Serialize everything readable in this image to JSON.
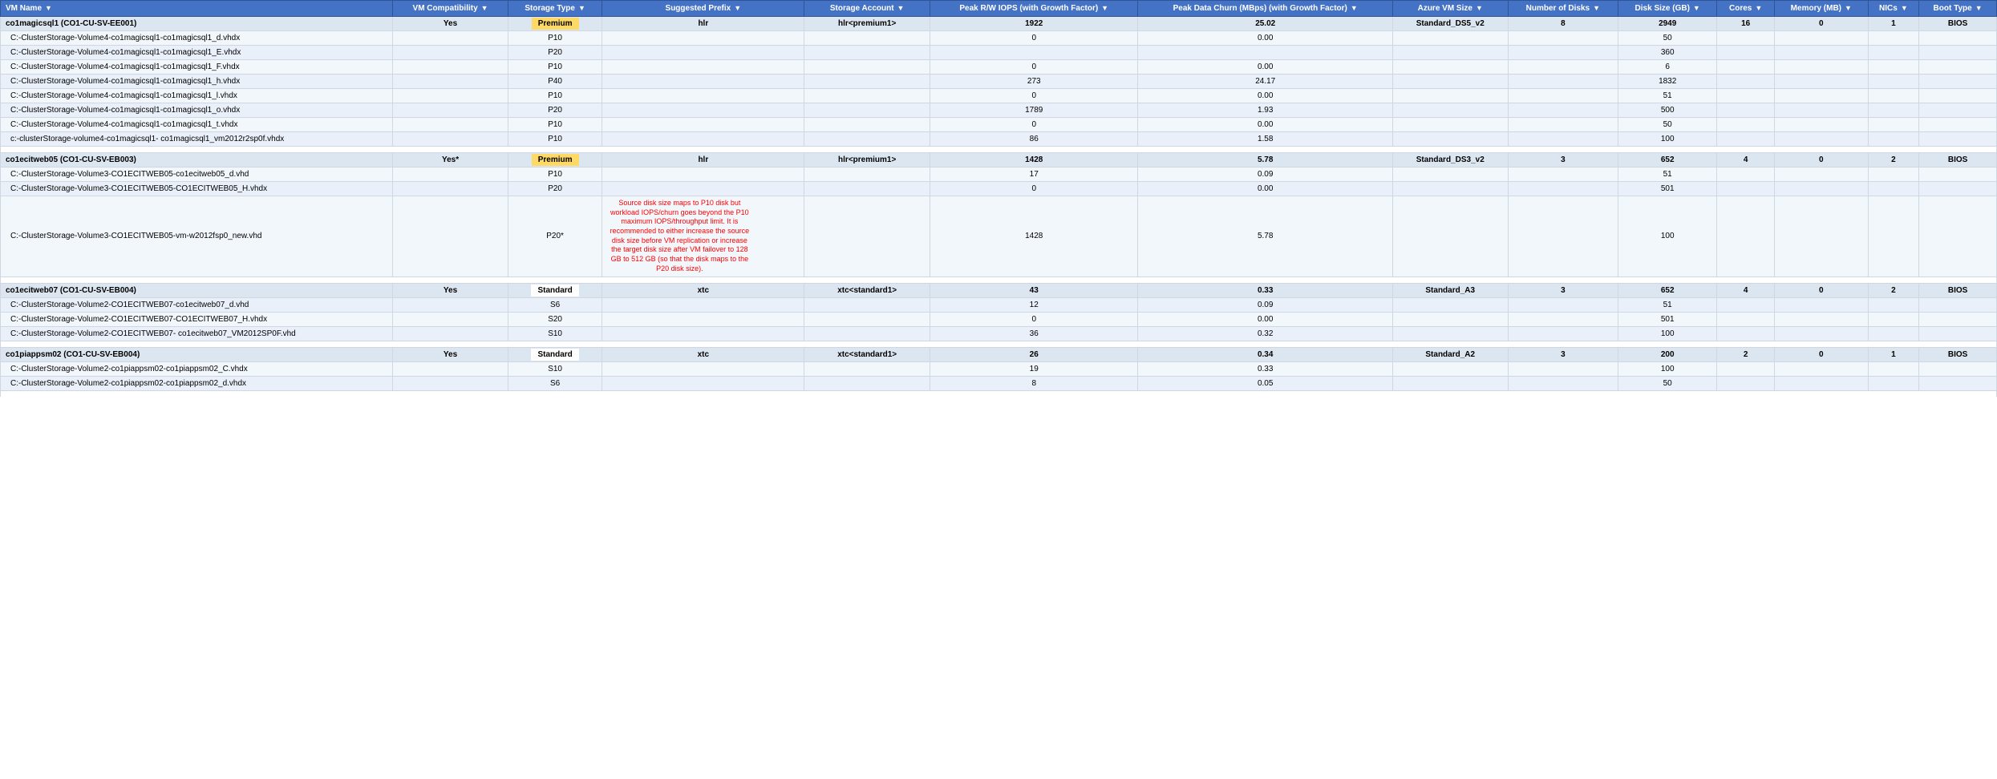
{
  "columns": [
    {
      "id": "vm-name",
      "label": "VM Name",
      "class": "col-vm-name"
    },
    {
      "id": "vm-compat",
      "label": "VM Compatibility",
      "class": "col-vm-compat"
    },
    {
      "id": "storage-type",
      "label": "Storage Type",
      "class": "col-storage-type"
    },
    {
      "id": "suggested-prefix",
      "label": "Suggested Prefix",
      "class": "col-suggested-prefix"
    },
    {
      "id": "storage-account",
      "label": "Storage Account",
      "class": "col-storage-account"
    },
    {
      "id": "peak-rw",
      "label": "Peak R/W IOPS (with Growth Factor)",
      "class": "col-peak-rw"
    },
    {
      "id": "peak-churn",
      "label": "Peak Data Churn (MBps) (with Growth Factor)",
      "class": "col-peak-churn"
    },
    {
      "id": "azure-vm",
      "label": "Azure VM Size",
      "class": "col-azure-vm"
    },
    {
      "id": "num-disks",
      "label": "Number of Disks",
      "class": "col-num-disks"
    },
    {
      "id": "disk-size",
      "label": "Disk Size (GB)",
      "class": "col-disk-size"
    },
    {
      "id": "cores",
      "label": "Cores",
      "class": "col-cores"
    },
    {
      "id": "memory",
      "label": "Memory (MB)",
      "class": "col-memory"
    },
    {
      "id": "nics",
      "label": "NICs",
      "class": "col-nics"
    },
    {
      "id": "boot-type",
      "label": "Boot Type",
      "class": "col-boot-type"
    }
  ],
  "groups": [
    {
      "vm": {
        "name": "co1magicsql1 (CO1-CU-SV-EE001)",
        "compat": "Yes",
        "storageType": "Premium",
        "storageTypeBadge": "premium",
        "suggestedPrefix": "hlr",
        "storageAccount": "hlr<premium1>",
        "peakRW": "1922",
        "peakChurn": "25.02",
        "azureVM": "Standard_DS5_v2",
        "numDisks": "8",
        "diskSize": "2949",
        "cores": "16",
        "memory": "0",
        "nics": "1",
        "bootType": "BIOS"
      },
      "disks": [
        {
          "name": "C:-ClusterStorage-Volume4-co1magicsql1-co1magicsql1_d.vhdx",
          "storageType": "P10",
          "peakRW": "0",
          "peakChurn": "0.00",
          "diskSize": "50"
        },
        {
          "name": "C:-ClusterStorage-Volume4-co1magicsql1-co1magicsql1_E.vhdx",
          "storageType": "P20",
          "peakRW": "",
          "peakChurn": "",
          "diskSize": "360"
        },
        {
          "name": "C:-ClusterStorage-Volume4-co1magicsql1-co1magicsql1_F.vhdx",
          "storageType": "P10",
          "peakRW": "0",
          "peakChurn": "0.00",
          "diskSize": "6"
        },
        {
          "name": "C:-ClusterStorage-Volume4-co1magicsql1-co1magicsql1_h.vhdx",
          "storageType": "P40",
          "peakRW": "273",
          "peakChurn": "24.17",
          "diskSize": "1832"
        },
        {
          "name": "C:-ClusterStorage-Volume4-co1magicsql1-co1magicsql1_l.vhdx",
          "storageType": "P10",
          "peakRW": "0",
          "peakChurn": "0.00",
          "diskSize": "51"
        },
        {
          "name": "C:-ClusterStorage-Volume4-co1magicsql1-co1magicsql1_o.vhdx",
          "storageType": "P20",
          "peakRW": "1789",
          "peakChurn": "1.93",
          "diskSize": "500"
        },
        {
          "name": "C:-ClusterStorage-Volume4-co1magicsql1-co1magicsql1_t.vhdx",
          "storageType": "P10",
          "peakRW": "0",
          "peakChurn": "0.00",
          "diskSize": "50"
        },
        {
          "name": "c:-clusterStorage-volume4-co1magicsql1-\nco1magicsql1_vm2012r2sp0f.vhdx",
          "storageType": "P10",
          "peakRW": "86",
          "peakChurn": "1.58",
          "diskSize": "100"
        }
      ]
    },
    {
      "vm": {
        "name": "co1ecitweb05 (CO1-CU-SV-EB003)",
        "compat": "Yes*",
        "storageType": "Premium",
        "storageTypeBadge": "premium",
        "suggestedPrefix": "hlr",
        "storageAccount": "hlr<premium1>",
        "peakRW": "1428",
        "peakChurn": "5.78",
        "azureVM": "Standard_DS3_v2",
        "numDisks": "3",
        "diskSize": "652",
        "cores": "4",
        "memory": "0",
        "nics": "2",
        "bootType": "BIOS"
      },
      "disks": [
        {
          "name": "C:-ClusterStorage-Volume3-CO1ECITWEB05-co1ecitweb05_d.vhd",
          "storageType": "P10",
          "peakRW": "17",
          "peakChurn": "0.09",
          "diskSize": "51"
        },
        {
          "name": "C:-ClusterStorage-Volume3-CO1ECITWEB05-CO1ECITWEB05_H.vhdx",
          "storageType": "P20",
          "peakRW": "0",
          "peakChurn": "0.00",
          "diskSize": "501"
        },
        {
          "name": "C:-ClusterStorage-Volume3-CO1ECITWEB05-vm-w2012fsp0_new.vhd",
          "storageType": "P20*",
          "peakRW": "1428",
          "peakChurn": "5.78",
          "diskSize": "100",
          "warning": "Source disk size maps to P10 disk but workload IOPS/churn goes beyond the P10 maximum IOPS/throughput limit. It is recommended to either increase the source disk size before VM replication or increase the target disk size after VM failover to 128 GB to 512 GB (so that the disk maps to the P20 disk size)."
        }
      ]
    },
    {
      "vm": {
        "name": "co1ecitweb07 (CO1-CU-SV-EB004)",
        "compat": "Yes",
        "storageType": "Standard",
        "storageTypeBadge": "standard",
        "suggestedPrefix": "xtc",
        "storageAccount": "xtc<standard1>",
        "peakRW": "43",
        "peakChurn": "0.33",
        "azureVM": "Standard_A3",
        "numDisks": "3",
        "diskSize": "652",
        "cores": "4",
        "memory": "0",
        "nics": "2",
        "bootType": "BIOS"
      },
      "disks": [
        {
          "name": "C:-ClusterStorage-Volume2-CO1ECITWEB07-co1ecitweb07_d.vhd",
          "storageType": "S6",
          "peakRW": "12",
          "peakChurn": "0.09",
          "diskSize": "51"
        },
        {
          "name": "C:-ClusterStorage-Volume2-CO1ECITWEB07-CO1ECITWEB07_H.vhdx",
          "storageType": "S20",
          "peakRW": "0",
          "peakChurn": "0.00",
          "diskSize": "501"
        },
        {
          "name": "C:-ClusterStorage-Volume2-CO1ECITWEB07-\nco1ecitweb07_VM2012SP0F.vhd",
          "storageType": "S10",
          "peakRW": "36",
          "peakChurn": "0.32",
          "diskSize": "100"
        }
      ]
    },
    {
      "vm": {
        "name": "co1piappsm02 (CO1-CU-SV-EB004)",
        "compat": "Yes",
        "storageType": "Standard",
        "storageTypeBadge": "standard",
        "suggestedPrefix": "xtc",
        "storageAccount": "xtc<standard1>",
        "peakRW": "26",
        "peakChurn": "0.34",
        "azureVM": "Standard_A2",
        "numDisks": "3",
        "diskSize": "200",
        "cores": "2",
        "memory": "0",
        "nics": "1",
        "bootType": "BIOS"
      },
      "disks": [
        {
          "name": "C:-ClusterStorage-Volume2-co1piappsm02-co1piappsm02_C.vhdx",
          "storageType": "S10",
          "peakRW": "19",
          "peakChurn": "0.33",
          "diskSize": "100"
        },
        {
          "name": "C:-ClusterStorage-Volume2-co1piappsm02-co1piappsm02_d.vhdx",
          "storageType": "S6",
          "peakRW": "8",
          "peakChurn": "0.05",
          "diskSize": "50"
        }
      ]
    }
  ]
}
